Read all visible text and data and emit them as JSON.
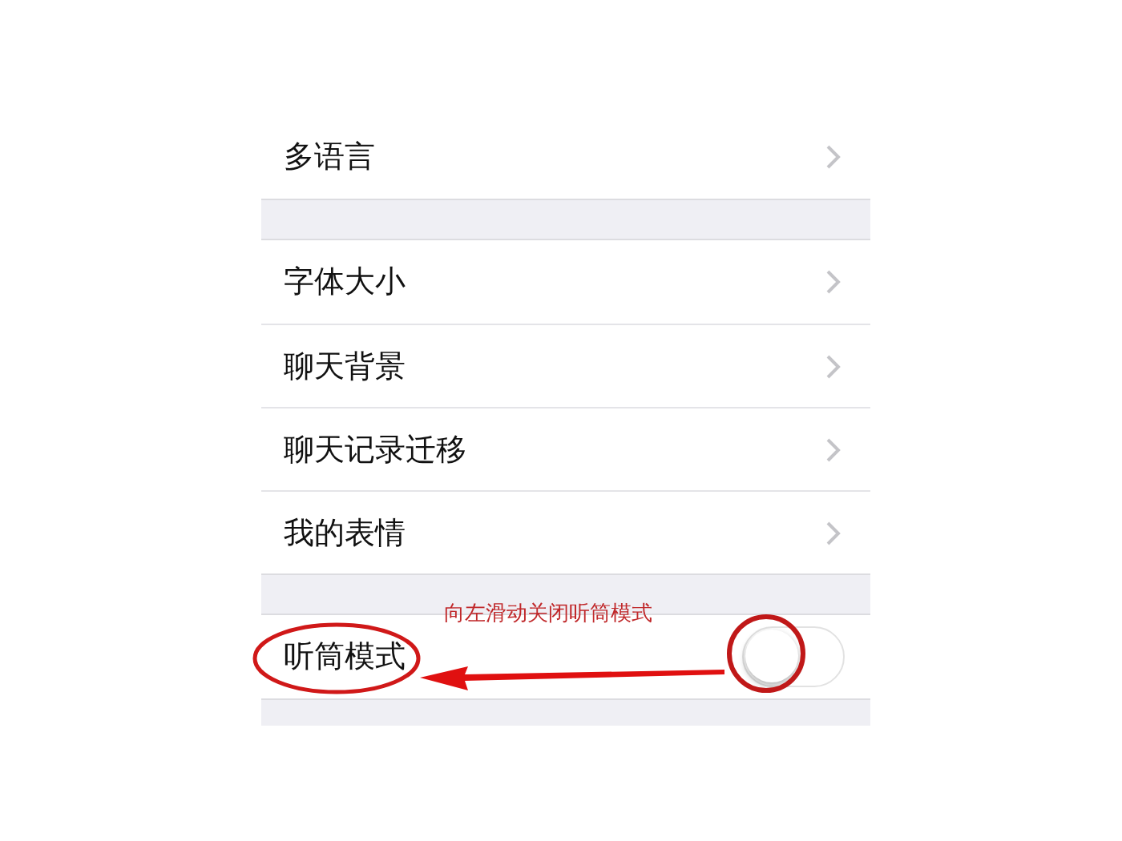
{
  "sections": [
    {
      "rows": [
        {
          "kind": "link",
          "label": "多语言"
        }
      ]
    },
    {
      "rows": [
        {
          "kind": "link",
          "label": "字体大小"
        },
        {
          "kind": "link",
          "label": "聊天背景"
        },
        {
          "kind": "link",
          "label": "聊天记录迁移"
        },
        {
          "kind": "link",
          "label": "我的表情"
        }
      ]
    },
    {
      "rows": [
        {
          "kind": "toggle",
          "label": "听筒模式",
          "on": false
        }
      ]
    }
  ],
  "annotation": {
    "note": "向左滑动关闭听筒模式"
  }
}
